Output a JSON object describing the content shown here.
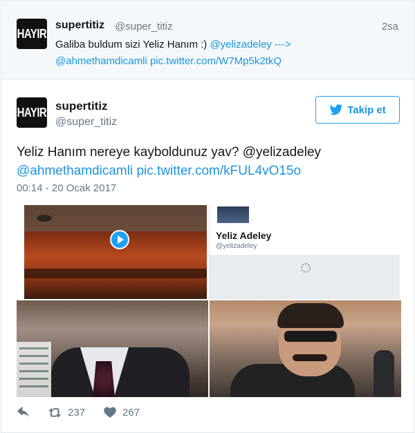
{
  "parent_tweet": {
    "avatar_text": "HAYIR",
    "name": "supertitiz",
    "handle": "@super_titiz",
    "time": "2sa",
    "text_plain": "Galiba buldum sizi Yeliz Hanım :) ",
    "mention": "@yelizadeley",
    "arrow": " --->",
    "mention2": "@ahmethamdicamli",
    "link": "pic.twitter.com/W7Mp5k2tkQ"
  },
  "main_tweet": {
    "avatar_text": "HAYIR",
    "name": "supertitiz",
    "handle": "@super_titiz",
    "follow_label": "Takip et",
    "text_plain": "Yeliz Hanım nereye kayboldunuz yav? ",
    "mention": "@yelizadeley",
    "mention2": "@ahmethamdicamli",
    "link": "pic.twitter.com/kFUL4vO15o",
    "date": "00:14 - 20 Ocak 2017"
  },
  "media": {
    "profile_name": "Yeliz Adeley",
    "profile_handle": "@yelizadeley"
  },
  "actions": {
    "retweets": "237",
    "likes": "267"
  },
  "colors": {
    "link": "#1b95e0",
    "muted": "#657786",
    "accent": "#1da1f2"
  }
}
